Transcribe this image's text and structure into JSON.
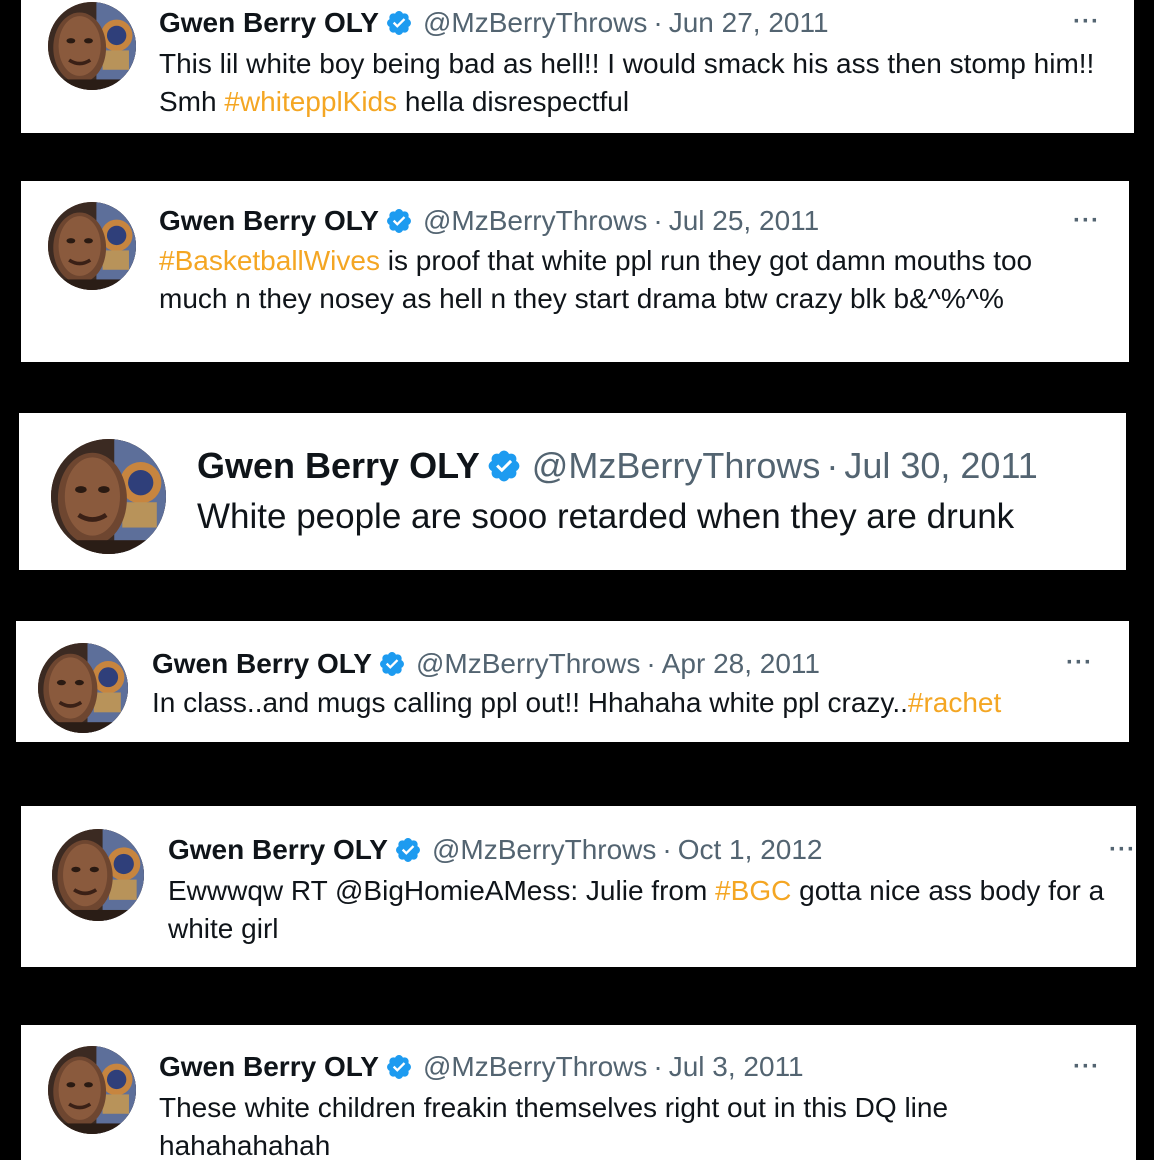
{
  "profile": {
    "display_name": "Gwen Berry OLY",
    "handle": "@MzBerryThrows",
    "verified_icon": "verified-badge-icon",
    "badge_color": "#1d9bf0",
    "hashtag_color": "#f4a623"
  },
  "separator": "·",
  "more_icon": "···",
  "tweets": [
    {
      "date": "Jun 27, 2011",
      "parts": [
        "This lil white boy being bad as hell!! I would smack his ass then stomp him!! Smh ",
        "#whitepplKids",
        " hella disrespectful"
      ]
    },
    {
      "date": "Jul 25, 2011",
      "parts": [
        "",
        "#BasketballWives",
        " is proof that white ppl run they got damn mouths too much n they nosey as hell n they start drama btw crazy blk b&^%^%"
      ]
    },
    {
      "date": "Jul 30, 2011",
      "parts": [
        "White people are sooo retarded when they are drunk"
      ]
    },
    {
      "date": "Apr 28, 2011",
      "parts": [
        "In class..and mugs calling ppl out!! Hhahaha white ppl crazy..",
        "#rachet"
      ]
    },
    {
      "date": "Oct 1, 2012",
      "parts": [
        "Ewwwqw RT @BigHomieAMess: Julie from ",
        "#BGC",
        " gotta nice ass body for a white girl"
      ]
    },
    {
      "date": "Jul 3, 2011",
      "parts": [
        "These white children freakin themselves right out in this DQ line hahahahahah"
      ]
    }
  ]
}
